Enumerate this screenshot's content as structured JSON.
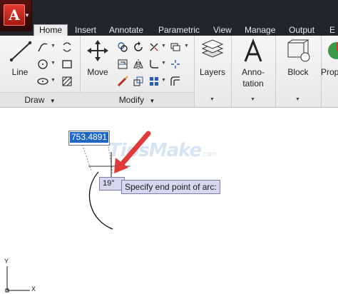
{
  "app": {
    "logo_letter": "A"
  },
  "tabs": [
    {
      "label": "Home",
      "active": true
    },
    {
      "label": "Insert"
    },
    {
      "label": "Annotate"
    },
    {
      "label": "Parametric"
    },
    {
      "label": "View"
    },
    {
      "label": "Manage"
    },
    {
      "label": "Output"
    },
    {
      "label": "E"
    }
  ],
  "ribbon": {
    "draw": {
      "title": "Draw",
      "line_label": "Line"
    },
    "modify": {
      "title": "Modify",
      "move_label": "Move"
    },
    "layers": {
      "label": "Layers"
    },
    "annotation": {
      "label_line1": "Anno-",
      "label_line2": "tation"
    },
    "block": {
      "label": "Block"
    },
    "properties": {
      "label": "Prop"
    }
  },
  "canvas": {
    "dynamic_input_value": "753.4891",
    "angle_value": "19°",
    "prompt_text": "Specify end point of arc:",
    "watermark_text": "TipsMake",
    "watermark_suffix": ".com",
    "ucs_y_label": "Y",
    "ucs_x_label": "X"
  }
}
